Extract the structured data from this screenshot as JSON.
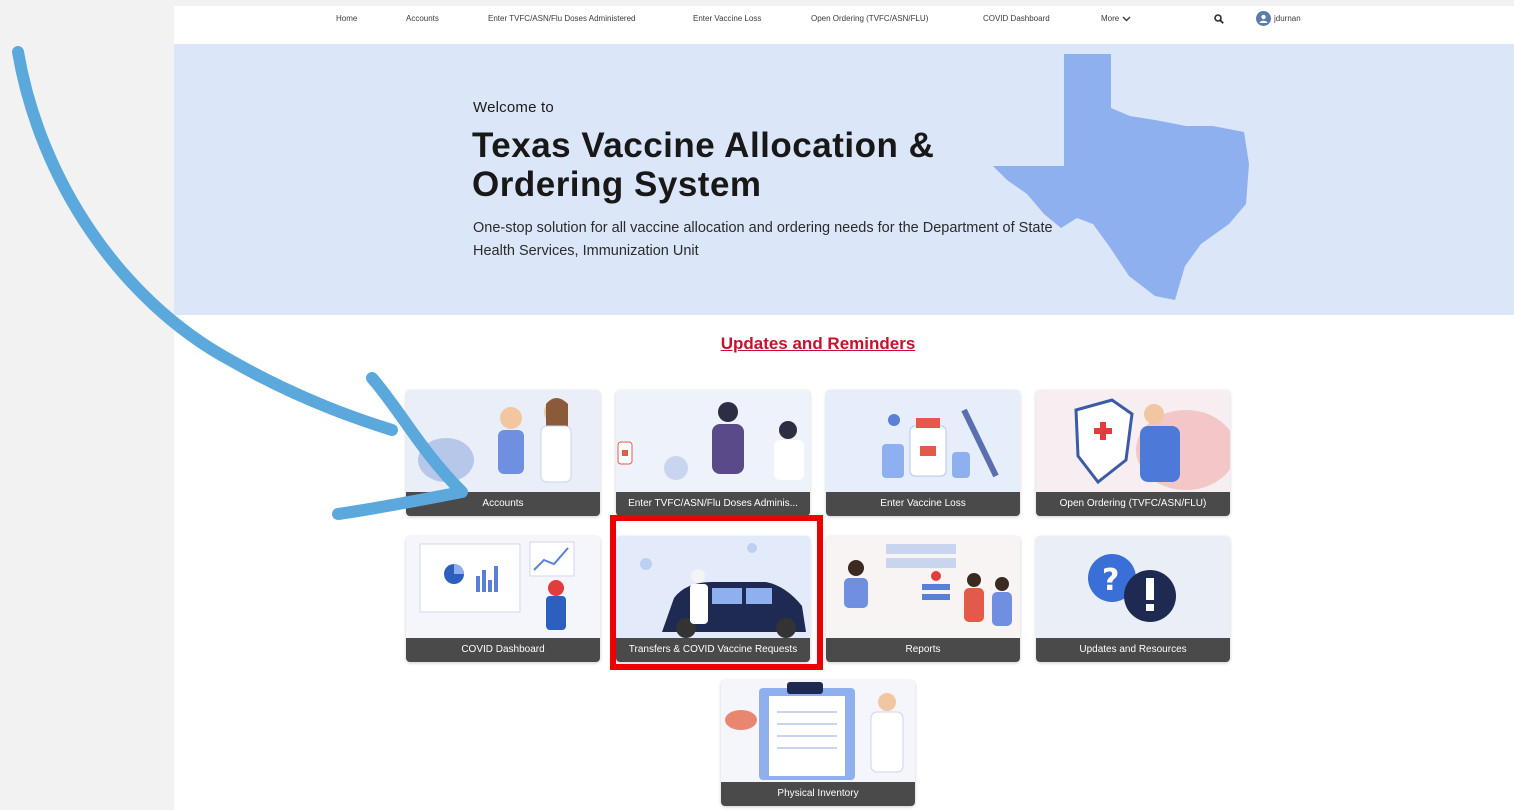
{
  "nav": {
    "items": [
      "Home",
      "Accounts",
      "Enter TVFC/ASN/Flu Doses Administered",
      "Enter Vaccine Loss",
      "Open Ordering (TVFC/ASN/FLU)",
      "COVID Dashboard"
    ],
    "more_label": "More",
    "user_label": "jdurnan"
  },
  "hero": {
    "welcome": "Welcome to",
    "title_line1": "Texas Vaccine Allocation &",
    "title_line2": "Ordering System",
    "subtitle_line1": "One-stop solution for all vaccine allocation and ordering needs for the Department of State",
    "subtitle_line2": "Health Services, Immunization Unit"
  },
  "updates_link": "Updates and Reminders",
  "tiles": [
    {
      "label": "Accounts"
    },
    {
      "label": "Enter TVFC/ASN/Flu Doses Adminis..."
    },
    {
      "label": "Enter Vaccine Loss"
    },
    {
      "label": "Open Ordering (TVFC/ASN/FLU)"
    },
    {
      "label": "COVID Dashboard"
    },
    {
      "label": "Transfers & COVID Vaccine Requests"
    },
    {
      "label": "Reports"
    },
    {
      "label": "Updates and Resources"
    },
    {
      "label": "Physical Inventory"
    }
  ],
  "colors": {
    "hero_bg": "#dbe6f8",
    "texas_shape": "#8fb0ee",
    "link_red": "#c8102e",
    "tile_label_bg": "#4a4a4a",
    "annotation_arrow": "#5aa8dc",
    "annotation_box": "#ee0000"
  },
  "icons": [
    "search-icon",
    "user-avatar-icon",
    "chevron-down-icon"
  ]
}
